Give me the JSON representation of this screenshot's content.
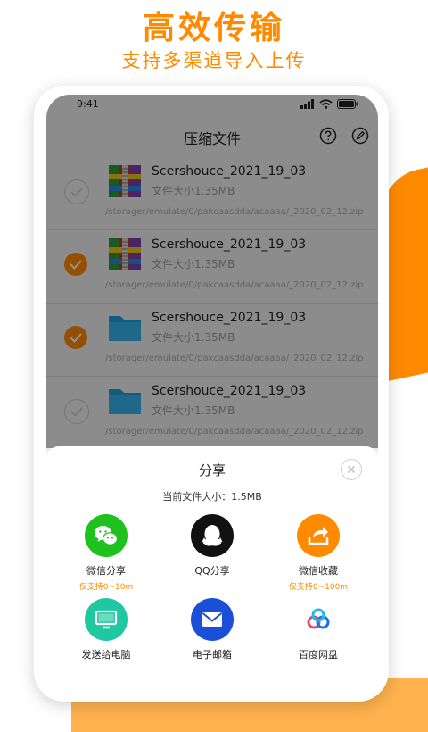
{
  "promo": {
    "title": "高效传输",
    "subtitle": "支持多渠道导入上传"
  },
  "status_bar": {
    "time": "9:41"
  },
  "app_bar": {
    "title": "压缩文件",
    "help_icon": "question-circle-icon",
    "edit_icon": "pen-circle-icon"
  },
  "files": [
    {
      "name": "Scershouce_2021_19_03",
      "size": "文件大小1.35MB",
      "path": "/storager/emulate/0/pakcaasdda/acaaaa/_2020_02_12.zip",
      "type": "zip-archive",
      "checked": false
    },
    {
      "name": "Scershouce_2021_19_03",
      "size": "文件大小1.35MB",
      "path": "/storager/emulate/0/pakcaasdda/acaaaa/_2020_02_12.zip",
      "type": "zip-archive",
      "checked": true
    },
    {
      "name": "Scershouce_2021_19_03",
      "size": "文件大小1.35MB",
      "path": "/storager/emulate/0/pakcaasdda/acaaaa/_2020_02_12.zip",
      "type": "folder",
      "checked": true
    },
    {
      "name": "Scershouce_2021_19_03",
      "size": "文件大小1.35MB",
      "path": "/storager/emulate/0/pakcaasdda/acaaaa/_2020_02_12.zip",
      "type": "folder",
      "checked": false
    }
  ],
  "share_sheet": {
    "title": "分享",
    "current_size": "当前文件大小：1.5MB",
    "items": [
      {
        "label": "微信分享",
        "note": "仅支持0~10m",
        "icon": "wechat-icon",
        "color": "#1fc11f"
      },
      {
        "label": "QQ分享",
        "note": "",
        "icon": "qq-penguin-icon",
        "color": "#111111"
      },
      {
        "label": "微信收藏",
        "note": "仅支持0~100m",
        "icon": "share-box-icon",
        "color": "#ff8a00"
      },
      {
        "label": "发送给电脑",
        "note": "",
        "icon": "monitor-icon",
        "color": "#1fc8a0"
      },
      {
        "label": "电子邮箱",
        "note": "",
        "icon": "mail-icon",
        "color": "#1a4fd8"
      },
      {
        "label": "百度网盘",
        "note": "",
        "icon": "baidu-netdisk-icon",
        "color": "#1a73e8"
      }
    ]
  },
  "colors": {
    "accent": "#ff8a00",
    "check_on": "#ff8a00"
  }
}
